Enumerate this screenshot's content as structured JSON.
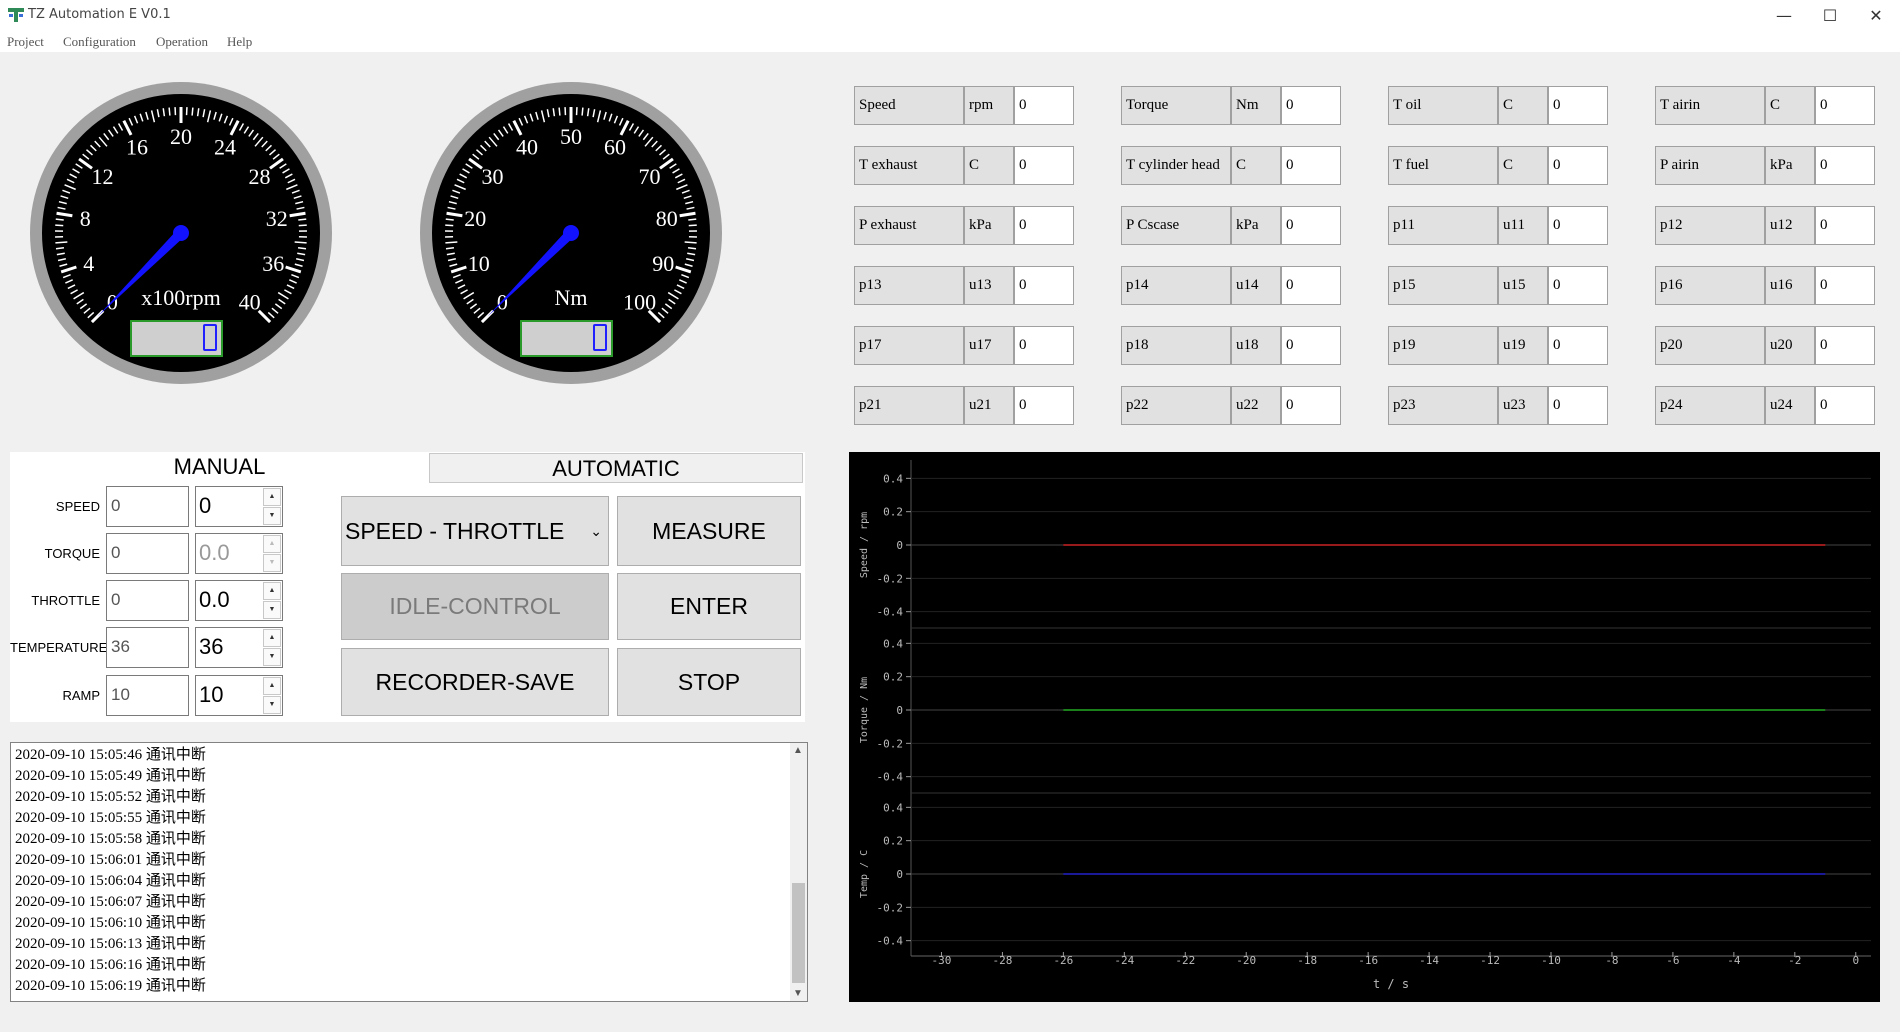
{
  "window": {
    "title": "TZ Automation E V0.1"
  },
  "menu": [
    "Project",
    "Configuration",
    "Operation",
    "Help"
  ],
  "gauges": [
    {
      "unit": "x100rpm",
      "ticks": [
        "0",
        "4",
        "8",
        "12",
        "16",
        "20",
        "24",
        "28",
        "32",
        "36",
        "40"
      ],
      "min": 0,
      "max": 40,
      "value": 0,
      "display": "0"
    },
    {
      "unit": "Nm",
      "ticks": [
        "0",
        "10",
        "20",
        "30",
        "40",
        "50",
        "60",
        "70",
        "80",
        "90",
        "100"
      ],
      "min": 0,
      "max": 100,
      "value": 0,
      "display": "0"
    }
  ],
  "params": [
    {
      "name": "Speed",
      "unit": "rpm",
      "value": "0"
    },
    {
      "name": "Torque",
      "unit": "Nm",
      "value": "0"
    },
    {
      "name": "T oil",
      "unit": "C",
      "value": "0"
    },
    {
      "name": "T airin",
      "unit": "C",
      "value": "0"
    },
    {
      "name": "T exhaust",
      "unit": "C",
      "value": "0"
    },
    {
      "name": "T cylinder head",
      "unit": "C",
      "value": "0"
    },
    {
      "name": "T fuel",
      "unit": "C",
      "value": "0"
    },
    {
      "name": "P airin",
      "unit": "kPa",
      "value": "0"
    },
    {
      "name": "P exhaust",
      "unit": "kPa",
      "value": "0"
    },
    {
      "name": "P Cscase",
      "unit": "kPa",
      "value": "0"
    },
    {
      "name": "p11",
      "unit": "u11",
      "value": "0"
    },
    {
      "name": "p12",
      "unit": "u12",
      "value": "0"
    },
    {
      "name": "p13",
      "unit": "u13",
      "value": "0"
    },
    {
      "name": "p14",
      "unit": "u14",
      "value": "0"
    },
    {
      "name": "p15",
      "unit": "u15",
      "value": "0"
    },
    {
      "name": "p16",
      "unit": "u16",
      "value": "0"
    },
    {
      "name": "p17",
      "unit": "u17",
      "value": "0"
    },
    {
      "name": "p18",
      "unit": "u18",
      "value": "0"
    },
    {
      "name": "p19",
      "unit": "u19",
      "value": "0"
    },
    {
      "name": "p20",
      "unit": "u20",
      "value": "0"
    },
    {
      "name": "p21",
      "unit": "u21",
      "value": "0"
    },
    {
      "name": "p22",
      "unit": "u22",
      "value": "0"
    },
    {
      "name": "p23",
      "unit": "u23",
      "value": "0"
    },
    {
      "name": "p24",
      "unit": "u24",
      "value": "0"
    }
  ],
  "tabs": {
    "manual": "MANUAL",
    "automatic": "AUTOMATIC"
  },
  "manual": [
    {
      "label": "SPEED",
      "input": "0",
      "spin": "0",
      "disabled": false
    },
    {
      "label": "TORQUE",
      "input": "0",
      "spin": "0.0",
      "disabled": true
    },
    {
      "label": "THROTTLE",
      "input": "0",
      "spin": "0.0",
      "disabled": false
    },
    {
      "label": "TEMPERATURE",
      "input": "36",
      "spin": "36",
      "disabled": false
    },
    {
      "label": "RAMP",
      "input": "10",
      "spin": "10",
      "disabled": false
    }
  ],
  "buttons": {
    "mode_select": "SPEED - THROTTLE",
    "measure": "MEASURE",
    "idle_control": "IDLE-CONTROL",
    "enter": "ENTER",
    "recorder_save": "RECORDER-SAVE",
    "stop": "STOP"
  },
  "log": [
    "2020-09-10 15:05:46  通讯中断",
    "2020-09-10 15:05:49  通讯中断",
    "2020-09-10 15:05:52  通讯中断",
    "2020-09-10 15:05:55  通讯中断",
    "2020-09-10 15:05:58  通讯中断",
    "2020-09-10 15:06:01  通讯中断",
    "2020-09-10 15:06:04  通讯中断",
    "2020-09-10 15:06:07  通讯中断",
    "2020-09-10 15:06:10  通讯中断",
    "2020-09-10 15:06:13  通讯中断",
    "2020-09-10 15:06:16  通讯中断",
    "2020-09-10 15:06:19  通讯中断"
  ],
  "chart_data": {
    "type": "line",
    "xlabel": "t / s",
    "xlim": [
      -31,
      0.5
    ],
    "xticks": [
      -30,
      -28,
      -26,
      -24,
      -22,
      -20,
      -18,
      -16,
      -14,
      -12,
      -10,
      -8,
      -6,
      -4,
      -2,
      0
    ],
    "background": "#000000",
    "panels": [
      {
        "ylabel": "Speed / rpm",
        "ylim": [
          -0.45,
          0.45
        ],
        "yticks": [
          0.4,
          0.2,
          0,
          -0.2,
          -0.4
        ],
        "series": [
          {
            "color": "#cc2222",
            "x": [
              -26,
              -1
            ],
            "y": [
              0,
              0
            ]
          }
        ]
      },
      {
        "ylabel": "Torque / Nm",
        "ylim": [
          -0.45,
          0.45
        ],
        "yticks": [
          0.4,
          0.2,
          0,
          -0.2,
          -0.4
        ],
        "series": [
          {
            "color": "#22aa22",
            "x": [
              -26,
              -1
            ],
            "y": [
              0,
              0
            ]
          }
        ]
      },
      {
        "ylabel": "Temp / C",
        "ylim": [
          -0.45,
          0.45
        ],
        "yticks": [
          0.4,
          0.2,
          0,
          -0.2,
          -0.4
        ],
        "series": [
          {
            "color": "#2222cc",
            "x": [
              -26,
              -1
            ],
            "y": [
              0,
              0
            ]
          }
        ]
      }
    ]
  }
}
